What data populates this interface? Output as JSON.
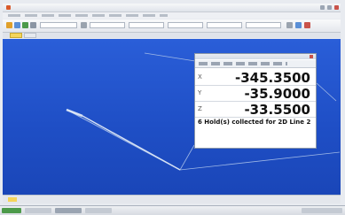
{
  "readout": {
    "axes": [
      {
        "axis": "X",
        "value": "-345.3500"
      },
      {
        "axis": "Y",
        "value": "-35.9000"
      },
      {
        "axis": "Z",
        "value": "-33.5500"
      }
    ],
    "message": "6 Hold(s) collected for 2D Line 2"
  },
  "colors": {
    "viewport_bg": "#2353cc",
    "tab_active": "#f4d55a"
  },
  "icons": {
    "title_app": "app-logo-icon",
    "toolbar": [
      "new-icon",
      "open-icon",
      "save-icon",
      "print-icon",
      "measure-icon",
      "settings-icon"
    ]
  }
}
